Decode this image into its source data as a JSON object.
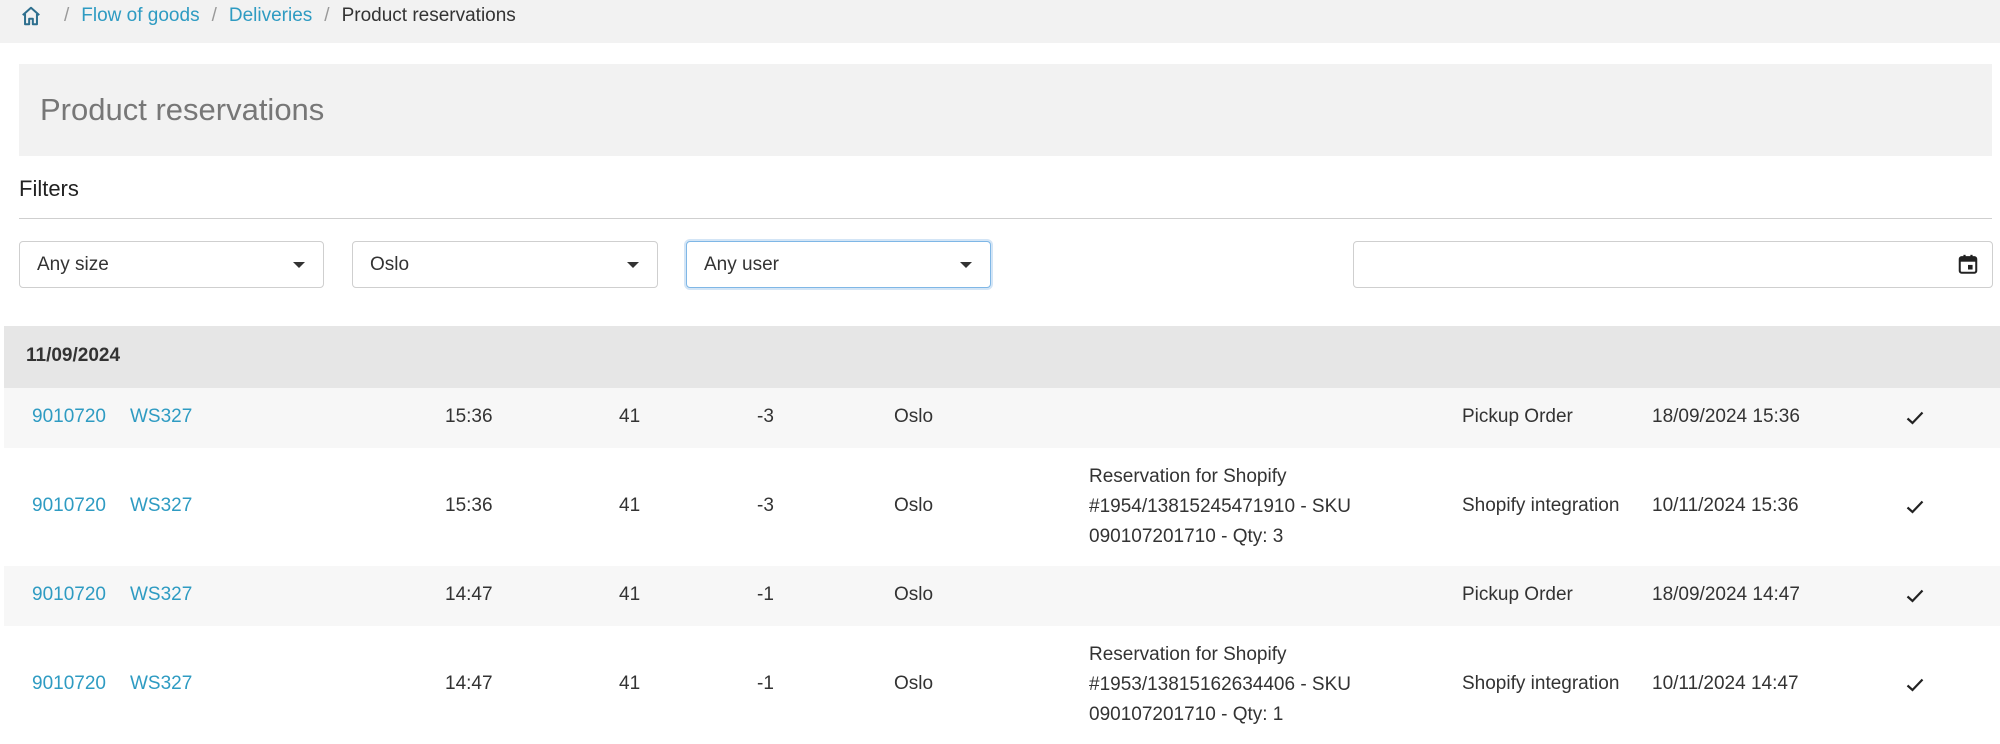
{
  "breadcrumb": {
    "home_icon": "home-icon",
    "items": [
      {
        "label": "Flow of goods",
        "link": true
      },
      {
        "label": "Deliveries",
        "link": true
      },
      {
        "label": "Product reservations",
        "link": false
      }
    ]
  },
  "page": {
    "title": "Product reservations"
  },
  "filters": {
    "label": "Filters",
    "size": {
      "value": "Any size"
    },
    "location": {
      "value": "Oslo"
    },
    "user": {
      "value": "Any user"
    },
    "date": {
      "value": "",
      "icon": "calendar-icon"
    }
  },
  "colors": {
    "link": "#2e9bc2",
    "header_bg": "#e6e6e6",
    "panel_bg": "#f2f2f2"
  },
  "group": {
    "date": "11/09/2024"
  },
  "rows": [
    {
      "product_no": "9010720",
      "style": "WS327",
      "time": "15:36",
      "size": "41",
      "qty": "-3",
      "location": "Oslo",
      "comment": "",
      "source": "Pickup Order",
      "expires": "18/09/2024 15:36",
      "status_icon": "check-icon"
    },
    {
      "product_no": "9010720",
      "style": "WS327",
      "time": "15:36",
      "size": "41",
      "qty": "-3",
      "location": "Oslo",
      "comment": "Reservation for Shopify #1954/13815245471910 - SKU 090107201710 - Qty: 3",
      "source": "Shopify integration",
      "expires": "10/11/2024 15:36",
      "status_icon": "check-icon"
    },
    {
      "product_no": "9010720",
      "style": "WS327",
      "time": "14:47",
      "size": "41",
      "qty": "-1",
      "location": "Oslo",
      "comment": "",
      "source": "Pickup Order",
      "expires": "18/09/2024 14:47",
      "status_icon": "check-icon"
    },
    {
      "product_no": "9010720",
      "style": "WS327",
      "time": "14:47",
      "size": "41",
      "qty": "-1",
      "location": "Oslo",
      "comment": "Reservation for Shopify #1953/13815162634406 - SKU 090107201710 - Qty: 1",
      "source": "Shopify integration",
      "expires": "10/11/2024 14:47",
      "status_icon": "check-icon"
    }
  ]
}
